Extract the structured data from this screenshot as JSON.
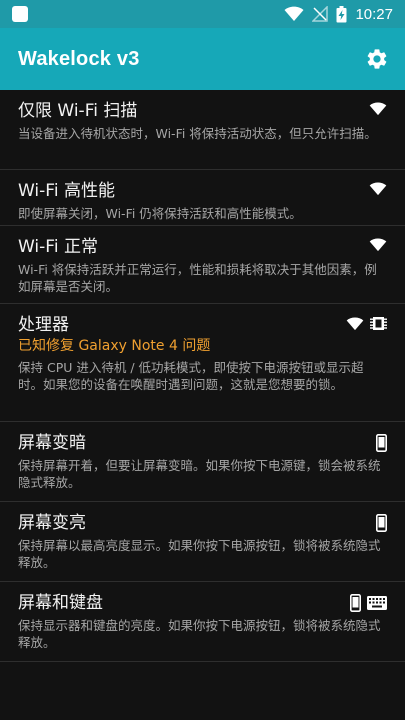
{
  "status_bar": {
    "time": "10:27",
    "icons": [
      "app-notification-icon",
      "wifi-icon",
      "no-signal-icon",
      "battery-charging-icon"
    ]
  },
  "app_bar": {
    "title": "Wakelock v3",
    "settings_icon": "gear-icon"
  },
  "items": [
    {
      "title": "仅限 Wi-Fi 扫描",
      "warning": "",
      "description": "当设备进入待机状态时，Wi-Fi 将保持活动状态，但只允许扫描。",
      "icons": [
        "wifi-icon"
      ]
    },
    {
      "title": "Wi-Fi 高性能",
      "warning": "",
      "description": "即使屏幕关闭，Wi-Fi 仍将保持活跃和高性能模式。",
      "icons": [
        "wifi-icon"
      ]
    },
    {
      "title": "Wi-Fi 正常",
      "warning": "",
      "description": "Wi-Fi 将保持活跃并正常运行，性能和损耗将取决于其他因素，例如屏幕是否关闭。",
      "icons": [
        "wifi-icon"
      ]
    },
    {
      "title": "处理器",
      "warning": "已知修复 Galaxy Note 4 问题",
      "description": "保持 CPU 进入待机 / 低功耗模式，即使按下电源按钮或显示超时。如果您的设备在唤醒时遇到问题，这就是您想要的锁。",
      "icons": [
        "wifi-icon",
        "cpu-chip-icon"
      ]
    },
    {
      "title": "屏幕变暗",
      "warning": "",
      "description": "保持屏幕开着，但要让屏幕变暗。如果你按下电源键，锁会被系统隐式释放。",
      "icons": [
        "phone-icon"
      ]
    },
    {
      "title": "屏幕变亮",
      "warning": "",
      "description": "保持屏幕以最高亮度显示。如果你按下电源按钮，锁将被系统隐式释放。",
      "icons": [
        "phone-icon"
      ]
    },
    {
      "title": "屏幕和键盘",
      "warning": "",
      "description": "保持显示器和键盘的亮度。如果你按下电源按钮，锁将被系统隐式释放。",
      "icons": [
        "phone-icon",
        "keyboard-icon"
      ]
    }
  ]
}
